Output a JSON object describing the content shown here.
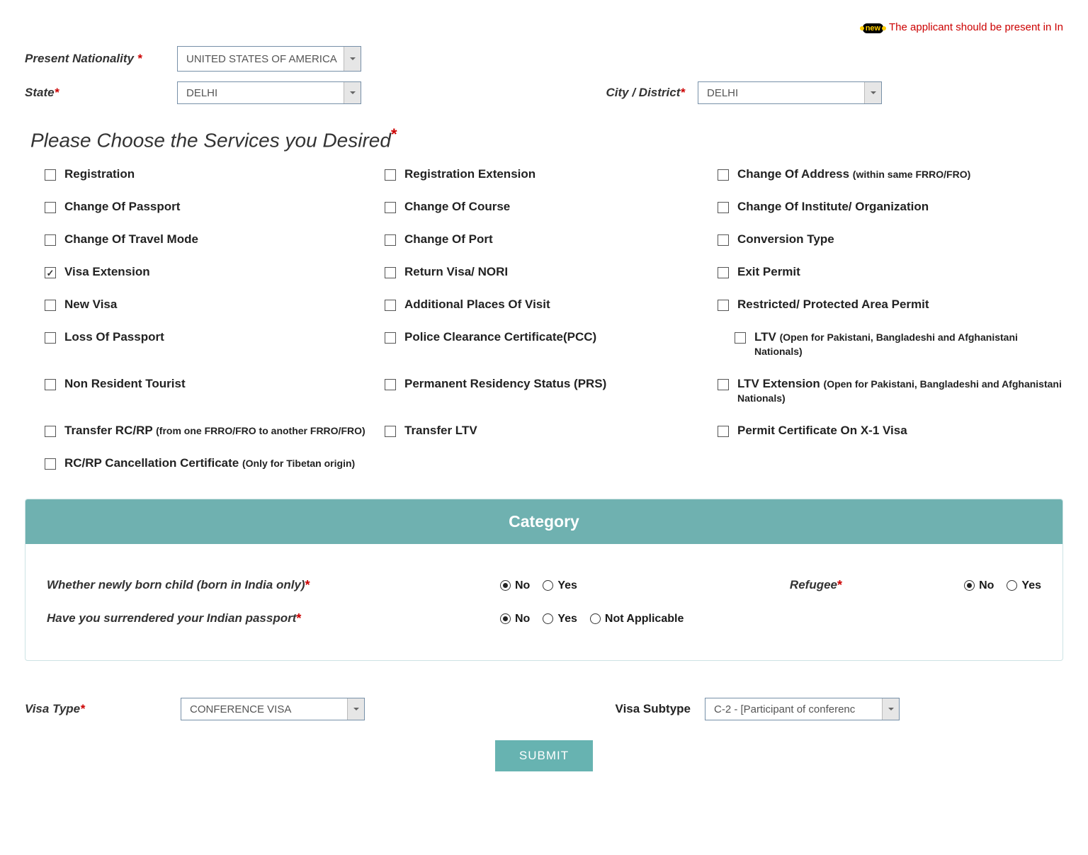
{
  "marquee": {
    "badge": "new",
    "text": "The applicant should be present in In"
  },
  "fields": {
    "present_nationality_label": "Present Nationality",
    "present_nationality_value": "UNITED STATES OF AMERICA",
    "state_label": "State",
    "state_value": "DELHI",
    "city_label": "City / District",
    "city_value": "DELHI",
    "visa_type_label": "Visa Type",
    "visa_type_value": "CONFERENCE VISA",
    "visa_subtype_label": "Visa Subtype",
    "visa_subtype_value": "C-2 - [Participant of conferenc"
  },
  "services": {
    "heading": "Please Choose the Services you Desired",
    "items": [
      {
        "label": "Registration",
        "checked": false
      },
      {
        "label": "Registration Extension",
        "checked": false
      },
      {
        "label": "Change Of Address ",
        "sub": "(within same FRRO/FRO)",
        "checked": false
      },
      {
        "label": "Change Of Passport",
        "checked": false
      },
      {
        "label": "Change Of Course",
        "checked": false
      },
      {
        "label": "Change Of Institute/ Organization",
        "checked": false
      },
      {
        "label": "Change Of Travel Mode",
        "checked": false
      },
      {
        "label": "Change Of Port",
        "checked": false
      },
      {
        "label": "Conversion Type",
        "checked": false
      },
      {
        "label": "Visa Extension",
        "checked": true
      },
      {
        "label": "Return Visa/ NORI",
        "checked": false
      },
      {
        "label": "Exit Permit",
        "checked": false
      },
      {
        "label": "New Visa",
        "checked": false
      },
      {
        "label": "Additional Places Of Visit",
        "checked": false
      },
      {
        "label": "Restricted/ Protected Area Permit",
        "checked": false
      },
      {
        "label": "Loss Of Passport",
        "checked": false
      },
      {
        "label": "Police Clearance Certificate(PCC)",
        "checked": false
      },
      {
        "label": "LTV ",
        "sub": "(Open for Pakistani, Bangladeshi and Afghanistani Nationals)",
        "checked": false,
        "indent": true
      },
      {
        "label": "Non Resident Tourist",
        "checked": false
      },
      {
        "label": "Permanent Residency Status (PRS)",
        "checked": false
      },
      {
        "label": "LTV Extension ",
        "sub": "(Open for Pakistani, Bangladeshi and Afghanistani Nationals)",
        "checked": false
      },
      {
        "label": "Transfer RC/RP ",
        "sub": "(from one FRRO/FRO to another FRRO/FRO)",
        "checked": false
      },
      {
        "label": "Transfer LTV",
        "checked": false
      },
      {
        "label": "Permit Certificate On X-1 Visa",
        "checked": false
      },
      {
        "label": "RC/RP Cancellation Certificate ",
        "sub": "(Only for Tibetan origin)",
        "checked": false
      }
    ]
  },
  "category": {
    "header": "Category",
    "q1_label": "Whether newly born child  (born in India only)",
    "q1_options": [
      "No",
      "Yes"
    ],
    "q1_selected": "No",
    "q2_label": "Have you surrendered your Indian passport",
    "q2_options": [
      "No",
      "Yes",
      "Not Applicable"
    ],
    "q2_selected": "No",
    "refugee_label": "Refugee",
    "refugee_options": [
      "No",
      "Yes"
    ],
    "refugee_selected": "No"
  },
  "buttons": {
    "submit": "SUBMIT"
  }
}
